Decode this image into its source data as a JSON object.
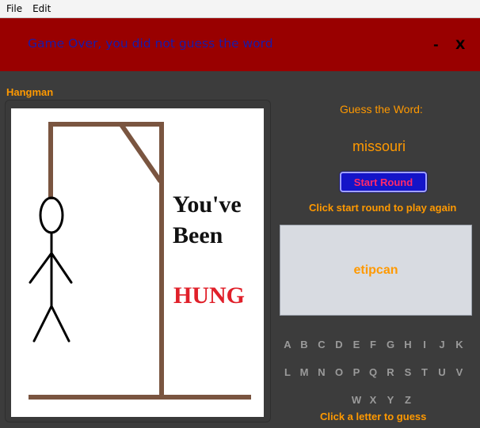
{
  "menu": {
    "file": "File",
    "edit": "Edit"
  },
  "header": {
    "message": "Game Over, you did not guess the word",
    "minimize": "-",
    "close": "X"
  },
  "panel": {
    "title": "Hangman"
  },
  "image": {
    "line1": "You've",
    "line2": "Been",
    "line3": "HUNG"
  },
  "game": {
    "guess_label": "Guess the Word:",
    "word": "missouri",
    "start_button": "Start Round",
    "instruction": "Click start round to play again",
    "guessed_letters": "etipcan",
    "footer": "Click a letter to guess"
  },
  "letters": [
    "A",
    "B",
    "C",
    "D",
    "E",
    "F",
    "G",
    "H",
    "I",
    "J",
    "K",
    "L",
    "M",
    "N",
    "O",
    "P",
    "Q",
    "R",
    "S",
    "T",
    "U",
    "V",
    "W",
    "X",
    "Y",
    "Z"
  ],
  "colors": {
    "header_bg": "#990000",
    "accent": "#ff9900",
    "bg": "#3c3c3c",
    "button": "#1414c8",
    "hung_text": "#e0202a",
    "gallows": "#7a5540"
  }
}
